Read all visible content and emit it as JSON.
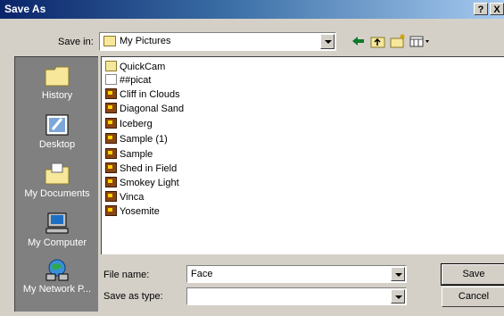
{
  "window": {
    "title": "Save As",
    "help_glyph": "?",
    "close_glyph": "X"
  },
  "save_in": {
    "label": "Save in:",
    "value": "My Pictures"
  },
  "toolbar": {
    "icons": [
      "back-arrow-icon",
      "up-folder-icon",
      "new-folder-icon",
      "view-menu-icon"
    ]
  },
  "places": [
    {
      "label": "History",
      "icon": "history-folder-icon"
    },
    {
      "label": "Desktop",
      "icon": "desktop-icon"
    },
    {
      "label": "My Documents",
      "icon": "my-documents-icon"
    },
    {
      "label": "My Computer",
      "icon": "my-computer-icon"
    },
    {
      "label": "My Network P...",
      "icon": "my-network-places-icon"
    }
  ],
  "files": [
    {
      "name": "QuickCam",
      "type": "folder"
    },
    {
      "name": "##picat",
      "type": "doc"
    },
    {
      "name": "Cliff in Clouds",
      "type": "image"
    },
    {
      "name": "Diagonal Sand",
      "type": "image"
    },
    {
      "name": "Iceberg",
      "type": "image"
    },
    {
      "name": "Sample (1)",
      "type": "image"
    },
    {
      "name": "Sample",
      "type": "image"
    },
    {
      "name": "Shed in Field",
      "type": "image"
    },
    {
      "name": "Smokey Light",
      "type": "image"
    },
    {
      "name": "Vinca",
      "type": "image"
    },
    {
      "name": "Yosemite",
      "type": "image"
    }
  ],
  "file_name": {
    "label": "File name:",
    "value": "Face"
  },
  "save_as_type": {
    "label": "Save as type:",
    "value": ""
  },
  "buttons": {
    "save": "Save",
    "cancel": "Cancel"
  }
}
